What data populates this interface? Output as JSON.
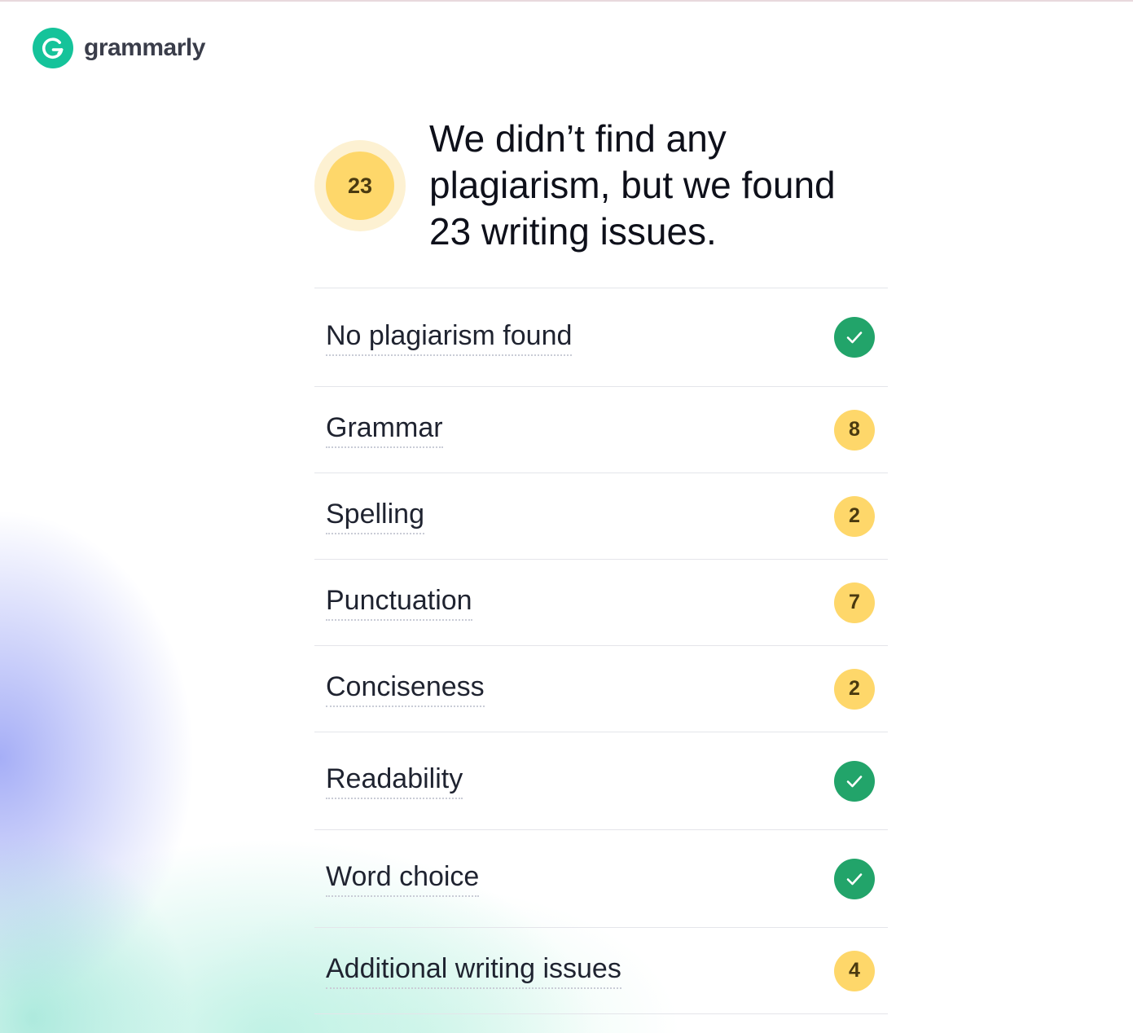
{
  "app": {
    "logo_text": "grammarly",
    "brand_color": "#15c39a"
  },
  "summary": {
    "total_issues": "23",
    "headline": "We didn’t find any plagiarism, but we found 23 writing issues.",
    "badge_color": "#fed76a"
  },
  "checks": [
    {
      "label": "No plagiarism found",
      "status": "ok",
      "icon": "check-circle-icon"
    },
    {
      "label": "Grammar",
      "status": "count",
      "count": "8"
    },
    {
      "label": "Spelling",
      "status": "count",
      "count": "2"
    },
    {
      "label": "Punctuation",
      "status": "count",
      "count": "7"
    },
    {
      "label": "Conciseness",
      "status": "count",
      "count": "2"
    },
    {
      "label": "Readability",
      "status": "ok",
      "icon": "check-circle-icon"
    },
    {
      "label": "Word choice",
      "status": "ok",
      "icon": "check-circle-icon"
    },
    {
      "label": "Additional writing issues",
      "status": "count",
      "count": "4"
    }
  ],
  "colors": {
    "ok": "#22a46a",
    "issue": "#fed76a"
  }
}
